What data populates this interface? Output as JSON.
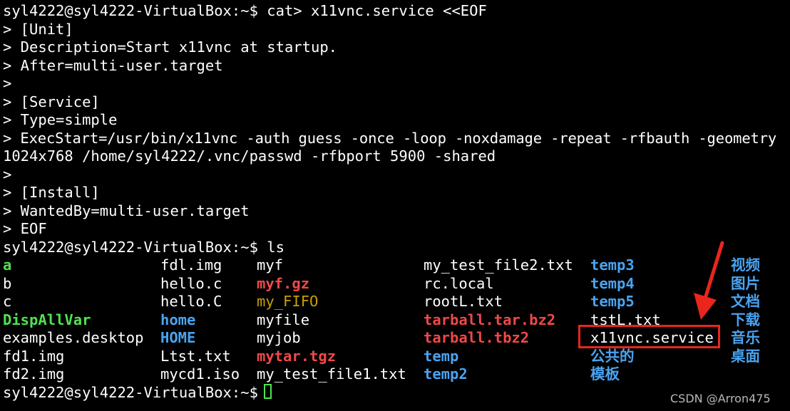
{
  "terminal": {
    "command_lines": [
      "syl4222@syl4222-VirtualBox:~$ cat> x11vnc.service <<EOF",
      "> [Unit]",
      "> Description=Start x11vnc at startup.",
      "> After=multi-user.target",
      ">",
      "> [Service]",
      "> Type=simple",
      "> ExecStart=/usr/bin/x11vnc -auth guess -once -loop -noxdamage -repeat -rfbauth -geometry",
      "1024x768 /home/syl4222/.vnc/passwd -rfbport 5900 -shared",
      ">",
      "> [Install]",
      "> WantedBy=multi-user.target",
      "> EOF",
      "syl4222@syl4222-VirtualBox:~$ ls"
    ],
    "ls_rows": [
      [
        "a",
        "fdl.img",
        "myf",
        "my_test_file2.txt",
        "temp3",
        "视频"
      ],
      [
        "b",
        "hello.c",
        "myf.gz",
        "rc.local",
        "temp4",
        "图片"
      ],
      [
        "c",
        "hello.C",
        "my_FIFO",
        "rootL.txt",
        "temp5",
        "文档"
      ],
      [
        "DispAllVar",
        "home",
        "myfile",
        "tarball.tar.bz2",
        "tstL.txt",
        "下载"
      ],
      [
        "examples.desktop",
        "HOME",
        "myjob",
        "tarball.tbz2",
        "x11vnc.service",
        "音乐"
      ],
      [
        "fd1.img",
        "Ltst.txt",
        "mytar.tgz",
        "temp",
        "公共的",
        "桌面"
      ],
      [
        "fd2.img",
        "mycd1.iso",
        "my_test_file1.txt",
        "temp2",
        "模板",
        ""
      ]
    ],
    "ls_kinds": [
      [
        "exec",
        "plain",
        "plain",
        "plain",
        "dir",
        "dir"
      ],
      [
        "plain",
        "plain",
        "archive",
        "plain",
        "dir",
        "dir"
      ],
      [
        "plain",
        "plain",
        "fifo",
        "plain",
        "dir",
        "dir"
      ],
      [
        "exec",
        "dir",
        "plain",
        "archive",
        "plain",
        "dir"
      ],
      [
        "plain",
        "dir",
        "plain",
        "archive",
        "plain",
        "dir"
      ],
      [
        "plain",
        "plain",
        "archive",
        "dir",
        "dir",
        "dir"
      ],
      [
        "plain",
        "plain",
        "plain",
        "dir",
        "dir",
        "dir"
      ]
    ],
    "final_prompt": "syl4222@syl4222-VirtualBox:~$ ",
    "highlighted_file": "x11vnc.service",
    "colors": {
      "background": "#000000",
      "text": "#ffffff",
      "executable": "#4fe34f",
      "directory": "#4aa3f0",
      "archive": "#f04848",
      "fifo": "#c8a000",
      "annotation": "#e8261e"
    }
  },
  "watermark": "CSDN @Arron475"
}
